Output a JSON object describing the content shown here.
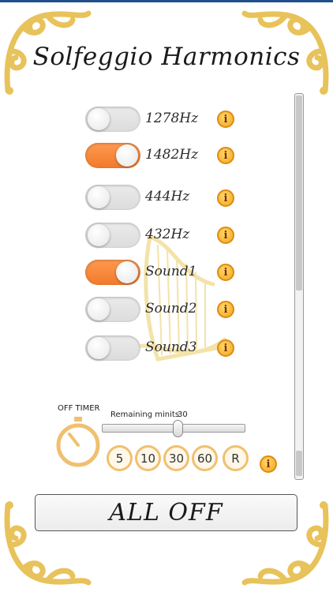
{
  "header": {
    "title": "Solfeggio Harmonics"
  },
  "sounds": [
    {
      "label": "1278Hz",
      "on": false
    },
    {
      "label": "1482Hz",
      "on": true
    },
    {
      "label": "444Hz",
      "on": false
    },
    {
      "label": "432Hz",
      "on": false
    },
    {
      "label": "Sound1",
      "on": true
    },
    {
      "label": "Sound2",
      "on": false
    },
    {
      "label": "Sound3",
      "on": false
    }
  ],
  "timer": {
    "off_timer_label": "OFF TIMER",
    "remaining_label": "Remaining minits",
    "remaining_value": "30",
    "slider_fraction": 0.55,
    "buttons": [
      "5",
      "10",
      "30",
      "60",
      "R"
    ]
  },
  "footer": {
    "all_off_label": "ALL OFF"
  },
  "colors": {
    "accent": "#f07a2c",
    "gold": "#e8c25a",
    "info": "#f0a820"
  },
  "icons": {
    "info": "info-icon",
    "timer": "stopwatch-icon",
    "ornament": "corner-ornament-icon",
    "harp": "harp-icon"
  }
}
